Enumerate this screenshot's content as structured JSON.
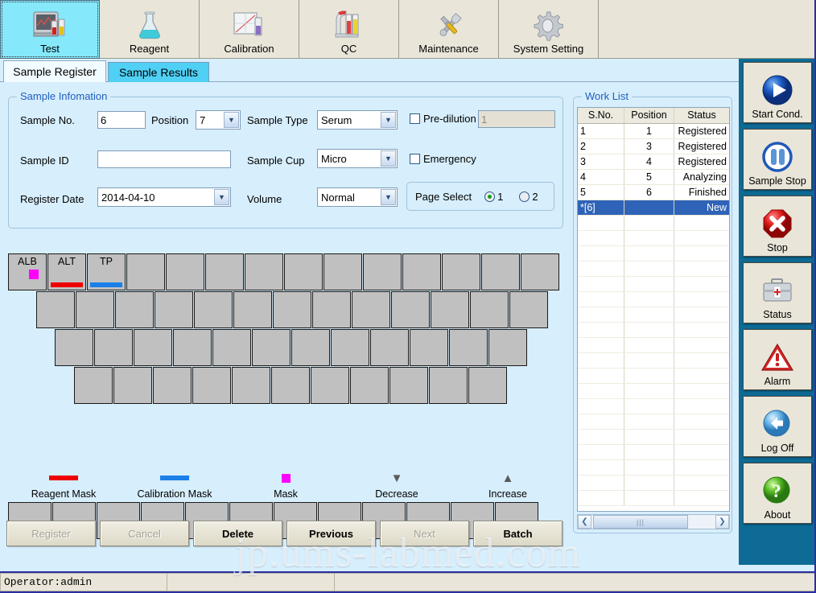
{
  "toolbar": {
    "buttons": [
      {
        "label": "Test",
        "icon": "analyzer-icon",
        "active": true
      },
      {
        "label": "Reagent",
        "icon": "flask-icon",
        "active": false
      },
      {
        "label": "Calibration",
        "icon": "calibration-chart-icon",
        "active": false
      },
      {
        "label": "QC",
        "icon": "qc-rack-icon",
        "active": false
      },
      {
        "label": "Maintenance",
        "icon": "tools-icon",
        "active": false
      },
      {
        "label": "System Setting",
        "icon": "gear-icon",
        "active": false
      }
    ]
  },
  "tabs": [
    {
      "label": "Sample Register",
      "active": true
    },
    {
      "label": "Sample Results",
      "active": false
    }
  ],
  "sample_information": {
    "title": "Sample Infomation",
    "sample_no": {
      "label": "Sample No.",
      "value": "6"
    },
    "position": {
      "label": "Position",
      "value": "7"
    },
    "sample_type": {
      "label": "Sample Type",
      "value": "Serum"
    },
    "sample_id": {
      "label": "Sample ID",
      "value": ""
    },
    "sample_cup": {
      "label": "Sample Cup",
      "value": "Micro"
    },
    "register_date": {
      "label": "Register Date",
      "value": "2014-04-10"
    },
    "volume": {
      "label": "Volume",
      "value": "Normal"
    },
    "pre_dilution": {
      "label": "Pre-dilution",
      "checked": false,
      "value": "1"
    },
    "emergency": {
      "label": "Emergency",
      "checked": false
    },
    "page_select": {
      "label": "Page Select",
      "options": [
        {
          "label": "1",
          "selected": true
        },
        {
          "label": "2",
          "selected": false
        }
      ]
    }
  },
  "work_list": {
    "title": "Work List",
    "columns": [
      "S.No.",
      "Position",
      "Status"
    ],
    "rows": [
      {
        "sno": "1",
        "position": "1",
        "status": "Registered",
        "selected": false
      },
      {
        "sno": "2",
        "position": "3",
        "status": "Registered",
        "selected": false
      },
      {
        "sno": "3",
        "position": "4",
        "status": "Registered",
        "selected": false
      },
      {
        "sno": "4",
        "position": "5",
        "status": "Analyzing",
        "selected": false
      },
      {
        "sno": "5",
        "position": "6",
        "status": "Finished",
        "selected": false
      },
      {
        "sno": "*[6]",
        "position": "",
        "status": "New",
        "selected": true
      }
    ],
    "empty_row_count": 19,
    "scrollbar": {
      "left_arrow": "❮",
      "right_arrow": "❯"
    }
  },
  "test_grid": {
    "rows": [
      {
        "offset": 0,
        "cells": [
          {
            "name": "ALB",
            "mask": true,
            "reagent_mask": false,
            "calibration_mask": false
          },
          {
            "name": "ALT",
            "mask": false,
            "reagent_mask": true,
            "calibration_mask": false
          },
          {
            "name": "TP",
            "mask": false,
            "reagent_mask": false,
            "calibration_mask": true
          },
          {
            "name": ""
          },
          {
            "name": ""
          },
          {
            "name": ""
          },
          {
            "name": ""
          },
          {
            "name": ""
          },
          {
            "name": ""
          },
          {
            "name": ""
          },
          {
            "name": ""
          },
          {
            "name": ""
          },
          {
            "name": ""
          },
          {
            "name": ""
          }
        ]
      },
      {
        "offset": 35,
        "count": 13
      },
      {
        "offset": 58,
        "count": 12
      },
      {
        "offset": 82,
        "count": 11
      }
    ],
    "bottom_row_count": 12
  },
  "legend": [
    {
      "label": "Reagent Mask",
      "swatch": "bar",
      "color": "#ef0000"
    },
    {
      "label": "Calibration Mask",
      "swatch": "bar",
      "color": "#1a7fe8"
    },
    {
      "label": "Mask",
      "swatch": "square",
      "color": "#ff00ff"
    },
    {
      "label": "Decrease",
      "swatch": "triangle-down",
      "color": "#5a5a5a"
    },
    {
      "label": "Increase",
      "swatch": "triangle-up",
      "color": "#5a5a5a"
    }
  ],
  "actions": [
    {
      "label": "Register",
      "enabled": false
    },
    {
      "label": "Cancel",
      "enabled": false
    },
    {
      "label": "Delete",
      "enabled": true
    },
    {
      "label": "Previous",
      "enabled": true
    },
    {
      "label": "Next",
      "enabled": false
    },
    {
      "label": "Batch",
      "enabled": true
    }
  ],
  "sidebar": [
    {
      "label": "Start Cond.",
      "icon": "play-icon"
    },
    {
      "label": "Sample Stop",
      "icon": "pause-icon"
    },
    {
      "label": "Stop",
      "icon": "stop-octagon-icon"
    },
    {
      "label": "Status",
      "icon": "medical-case-icon"
    },
    {
      "label": "Alarm",
      "icon": "warning-triangle-icon"
    },
    {
      "label": "Log Off",
      "icon": "back-arrow-icon"
    },
    {
      "label": "About",
      "icon": "question-mark-icon"
    }
  ],
  "watermark": "jp.ums-labmed.com",
  "status_bar": {
    "operator": "Operator:admin",
    "panel2": "",
    "panel3": ""
  }
}
